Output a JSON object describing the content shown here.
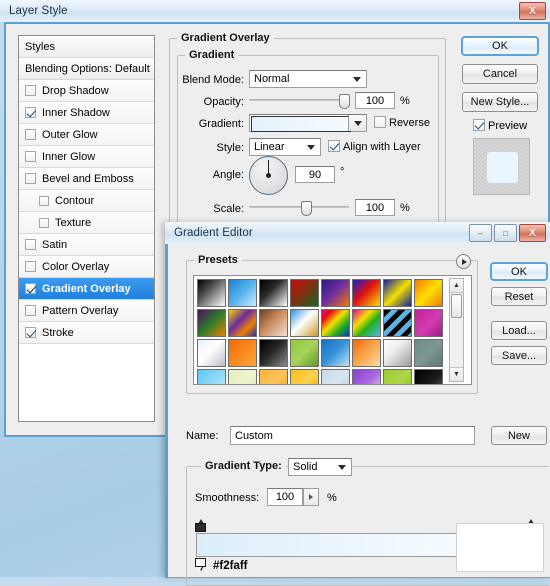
{
  "desktop": {
    "bg_color": "#b5d4ea"
  },
  "layer_style": {
    "title": "Layer Style",
    "close_label": "X",
    "styles_panel": {
      "header": "Styles",
      "blending_options": "Blending Options: Default",
      "items": [
        {
          "label": "Drop Shadow",
          "checked": false,
          "sub": false,
          "selected": false
        },
        {
          "label": "Inner Shadow",
          "checked": true,
          "sub": false,
          "selected": false
        },
        {
          "label": "Outer Glow",
          "checked": false,
          "sub": false,
          "selected": false
        },
        {
          "label": "Inner Glow",
          "checked": false,
          "sub": false,
          "selected": false
        },
        {
          "label": "Bevel and Emboss",
          "checked": false,
          "sub": false,
          "selected": false
        },
        {
          "label": "Contour",
          "checked": false,
          "sub": true,
          "selected": false
        },
        {
          "label": "Texture",
          "checked": false,
          "sub": true,
          "selected": false
        },
        {
          "label": "Satin",
          "checked": false,
          "sub": false,
          "selected": false
        },
        {
          "label": "Color Overlay",
          "checked": false,
          "sub": false,
          "selected": false
        },
        {
          "label": "Gradient Overlay",
          "checked": true,
          "sub": false,
          "selected": true
        },
        {
          "label": "Pattern Overlay",
          "checked": false,
          "sub": false,
          "selected": false
        },
        {
          "label": "Stroke",
          "checked": true,
          "sub": false,
          "selected": false
        }
      ]
    },
    "section_title": "Gradient Overlay",
    "gradient_group_title": "Gradient",
    "fields": {
      "blend_mode_label": "Blend Mode:",
      "blend_mode_value": "Normal",
      "opacity_label": "Opacity:",
      "opacity_value": "100",
      "opacity_unit": "%",
      "gradient_label": "Gradient:",
      "reverse_label": "Reverse",
      "reverse_checked": false,
      "style_label": "Style:",
      "style_value": "Linear",
      "align_label": "Align with Layer",
      "align_checked": true,
      "angle_label": "Angle:",
      "angle_value": "90",
      "angle_unit": "°",
      "scale_label": "Scale:",
      "scale_value": "100",
      "scale_unit": "%"
    },
    "buttons": {
      "ok": "OK",
      "cancel": "Cancel",
      "new_style": "New Style..."
    },
    "preview_label": "Preview",
    "preview_checked": true,
    "preview_swatch_color": "#eaf6ff",
    "gradient_preview_colors": [
      "#e4f1fb",
      "#f4fbff"
    ]
  },
  "gradient_editor": {
    "title": "Gradient Editor",
    "window_buttons": {
      "minimize": "–",
      "maximize": "□",
      "close": "X"
    },
    "presets_label": "Presets",
    "buttons": {
      "ok": "OK",
      "reset": "Reset",
      "load": "Load...",
      "save": "Save...",
      "new": "New"
    },
    "name_label": "Name:",
    "name_value": "Custom",
    "gradient_type_label": "Gradient Type:",
    "gradient_type_value": "Solid",
    "smoothness_label": "Smoothness:",
    "smoothness_value": "100",
    "smoothness_unit": "%",
    "selected_stop_hex": "#f2faff",
    "gradient_bar_colors": [
      "#dceefc",
      "#ffffff"
    ],
    "presets": [
      {
        "name": "foreground-to-background",
        "css": "linear-gradient(135deg,#000000 0%,#4a4a4a 35%,#ffffff 100%)"
      },
      {
        "name": "foreground-to-transparent",
        "css": "linear-gradient(135deg,#1e7fd4 0%,#56b4ea 50%,#cfeaff 100%)"
      },
      {
        "name": "black-white",
        "css": "linear-gradient(135deg,#000000 0%,#2a2a2a 40%,#ffffff 100%)"
      },
      {
        "name": "red-green",
        "css": "linear-gradient(135deg,#cc0b0b 0%,#7a3313 50%,#0d6b1e 100%)"
      },
      {
        "name": "violet-orange",
        "css": "linear-gradient(135deg,#2e1b7a 0%,#6b2ba0 45%,#f07a0a 100%)"
      },
      {
        "name": "blue-red-yellow",
        "css": "linear-gradient(135deg,#1520c8 0%,#e01010 45%,#f3e000 100%)"
      },
      {
        "name": "blue-yellow-blue",
        "css": "linear-gradient(135deg,#10219f 0%,#f5e000 50%,#10219f 100%)"
      },
      {
        "name": "orange-yellow-orange",
        "css": "linear-gradient(135deg,#f07b00 0%,#ffe000 50%,#f07b00 100%)"
      },
      {
        "name": "violet-green-orange",
        "css": "linear-gradient(135deg,#4b1060 0%,#2f7a2a 50%,#f08000 100%)"
      },
      {
        "name": "yellow-violet-orange-blue",
        "css": "linear-gradient(135deg,#f5d400 0%,#6b2ba0 40%,#f08000 70%,#1d2fb0 100%)"
      },
      {
        "name": "copper",
        "css": "linear-gradient(135deg,#6d4226 0%,#c98a5e 45%,#f3e0d0 100%)"
      },
      {
        "name": "chrome",
        "css": "linear-gradient(135deg,#2f8fd8 0%,#ffffff 45%,#c89a22 100%)"
      },
      {
        "name": "spectrum",
        "css": "linear-gradient(135deg,#e60a8c 0%,#e01010 20%,#f5e000 45%,#20b020 70%,#1030c8 100%)"
      },
      {
        "name": "transparent-rainbow",
        "css": "linear-gradient(135deg,#e60a8c 0%,#f5e000 35%,#20b020 60%,#56b4ea 100%)"
      },
      {
        "name": "transparent-stripes",
        "css": "repeating-linear-gradient(135deg,#000 0 5px,#56b4ea 5px 10px)"
      },
      {
        "name": "magenta-violet",
        "css": "linear-gradient(135deg,#c0209c 0%,#d43bb0 55%,#9c1b8a 100%)"
      },
      {
        "name": "blue-grey-steel",
        "css": "linear-gradient(135deg,#e8f2fb 0%,#ffffff 45%,#b8bfc6 100%)"
      },
      {
        "name": "orange-solid",
        "css": "linear-gradient(135deg,#f06a0a 0%,#f98c1e 55%,#f5a93e 100%)"
      },
      {
        "name": "black-charcoal",
        "css": "linear-gradient(135deg,#000000 0%,#262626 45%,#8a8a8a 100%)"
      },
      {
        "name": "green-dots",
        "css": "linear-gradient(135deg,#8ec93f 0%,#a6d45a 50%,#5f9b22 100%)"
      },
      {
        "name": "blue-sky",
        "css": "linear-gradient(135deg,#1670c0 0%,#3b95d8 50%,#bfe3f6 100%)"
      },
      {
        "name": "orange-white",
        "css": "linear-gradient(135deg,#f06a0a 0%,#f9a74e 50%,#ffd9a8 100%)"
      },
      {
        "name": "silver",
        "css": "linear-gradient(135deg,#ffffff 0%,#ededed 40%,#9b9b9b 100%)"
      },
      {
        "name": "slate-teal",
        "css": "linear-gradient(135deg,#6e8b86 0%,#7d9792 50%,#5d7a76 100%)"
      },
      {
        "name": "light-blue",
        "css": "linear-gradient(135deg,#5fc6f0 0%,#8dd8f6 50%,#cdeefc 100%)"
      },
      {
        "name": "pale-yellow",
        "css": "linear-gradient(135deg,#e8eec0 0%,#eef3cd 50%,#e0e8b4 100%)"
      },
      {
        "name": "amber",
        "css": "linear-gradient(135deg,#f9b233 0%,#fbc45c 50%,#f5a11e 100%)"
      },
      {
        "name": "gold",
        "css": "linear-gradient(135deg,#f9bf1e 0%,#fbd04c 50%,#f5ab0e 100%)"
      },
      {
        "name": "pale-steel-blue",
        "css": "linear-gradient(135deg,#c6d9e8 0%,#d8e6f1 50%,#b0c8dc 100%)"
      },
      {
        "name": "purple-white",
        "css": "linear-gradient(135deg,#8a3fd0 0%,#a768e0 50%,#e6d6f7 100%)"
      },
      {
        "name": "lime",
        "css": "linear-gradient(135deg,#9ccb30 0%,#aed648 50%,#8cbc20 100%)"
      },
      {
        "name": "black-fade",
        "css": "linear-gradient(135deg,#000000 0%,#1a1a1a 55%,#6a6a6a 100%)"
      }
    ]
  }
}
